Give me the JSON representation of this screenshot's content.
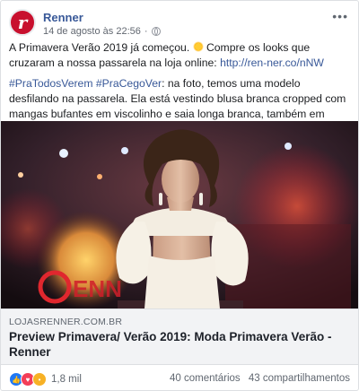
{
  "post": {
    "page_name": "Renner",
    "avatar_letter": "r",
    "timestamp": "14 de agosto às 22:56",
    "privacy_icon": "globe-icon",
    "more_icon": "more-options-icon",
    "more_label": "•••"
  },
  "text": {
    "line1_a": "A Primavera Verão 2019 já começou. ",
    "line1_b": " Compre os looks que cruzaram a nossa passarela na loja online: ",
    "link": "http://ren-ner.co/nNW",
    "hash1": "#PraTodosVerem",
    "hash2": "#PraCegoVer",
    "para2": ": na foto, temos uma modelo desfilando na passarela. Ela está vestindo blusa branca cropped com mangas bufantes em viscolinho e saia longa branca, também em viscolinho."
  },
  "link_preview": {
    "domain": "LOJASRENNER.COM.BR",
    "title": "Preview Primavera/ Verão 2019: Moda Primavera Verão - Renner"
  },
  "footer": {
    "reaction_count": "1,8 mil",
    "comments": "40 comentários",
    "shares": "43 compartilhamentos",
    "reactions": [
      "like-icon",
      "love-icon",
      "wow-icon"
    ]
  },
  "colors": {
    "link": "#385898",
    "brand": "#c8102e"
  }
}
